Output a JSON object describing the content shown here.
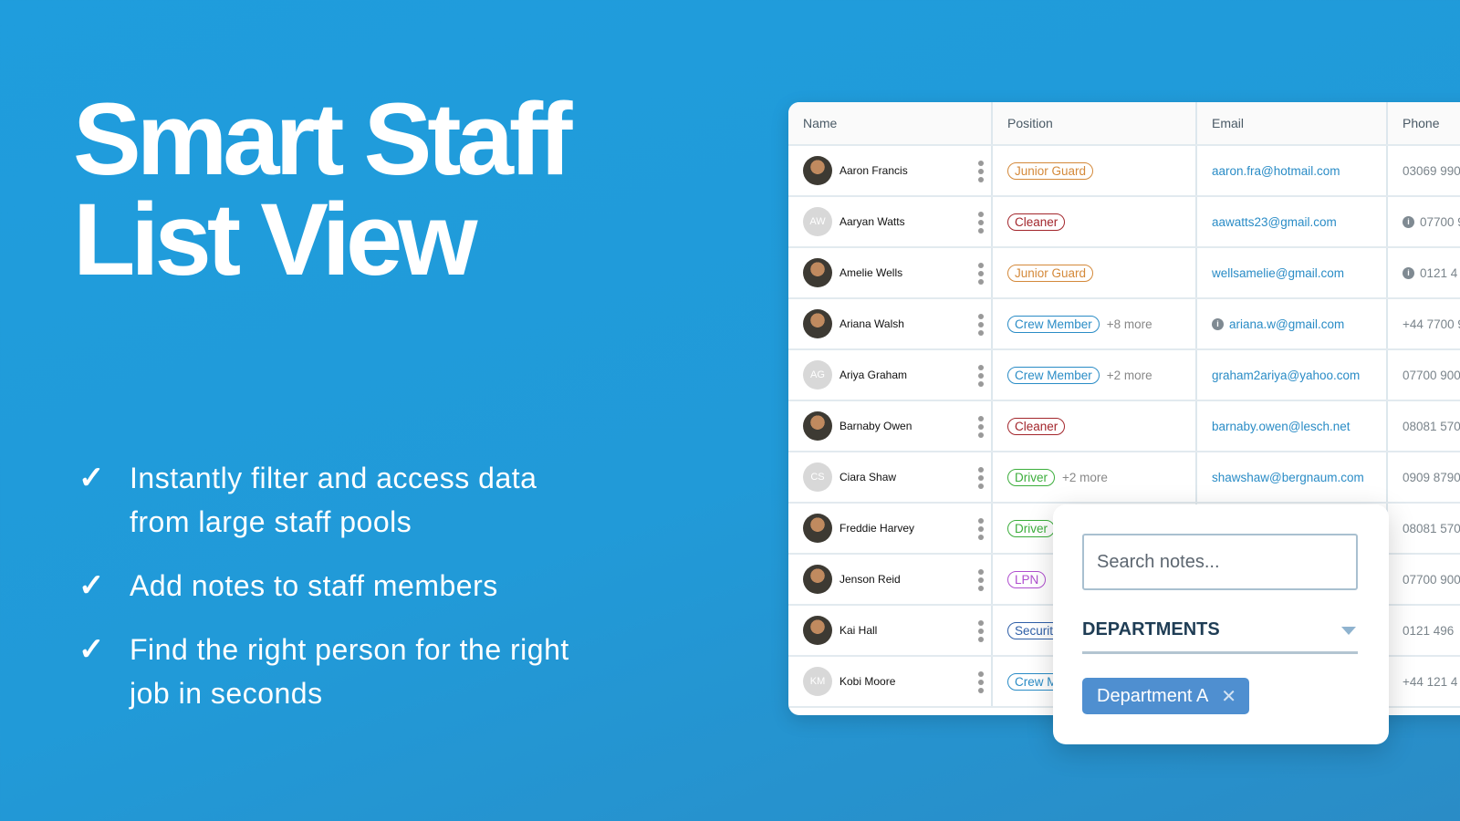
{
  "hero": {
    "title_line1": "Smart Staff",
    "title_line2": "List View",
    "bullets": [
      "Instantly filter and access data from large staff pools",
      "Add notes to staff members",
      "Find the right person for the right job in seconds"
    ]
  },
  "table": {
    "columns": [
      "Name",
      "Position",
      "Email",
      "Phone"
    ],
    "rows": [
      {
        "initials": "",
        "name": "Aaron Francis",
        "position": "Junior Guard",
        "pos_color": "#d4893a",
        "more": "",
        "email": "aaron.fra@hotmail.com",
        "email_info": false,
        "phone": "03069 990",
        "phone_info": false
      },
      {
        "initials": "AW",
        "name": "Aaryan Watts",
        "position": "Cleaner",
        "pos_color": "#a3262c",
        "more": "",
        "email": "aawatts23@gmail.com",
        "email_info": false,
        "phone": "07700 9",
        "phone_info": true
      },
      {
        "initials": "",
        "name": "Amelie Wells",
        "position": "Junior Guard",
        "pos_color": "#d4893a",
        "more": "",
        "email": "wellsamelie@gmail.com",
        "email_info": false,
        "phone": "0121 4",
        "phone_info": true
      },
      {
        "initials": "",
        "name": "Ariana Walsh",
        "position": "Crew Member",
        "pos_color": "#2a8cc6",
        "more": "+8 more",
        "email": "ariana.w@gmail.com",
        "email_info": true,
        "phone": "+44 7700 9",
        "phone_info": false
      },
      {
        "initials": "AG",
        "name": "Ariya Graham",
        "position": "Crew Member",
        "pos_color": "#2a8cc6",
        "more": "+2 more",
        "email": "graham2ariya@yahoo.com",
        "email_info": false,
        "phone": "07700 900",
        "phone_info": false
      },
      {
        "initials": "",
        "name": "Barnaby Owen",
        "position": "Cleaner",
        "pos_color": "#a3262c",
        "more": "",
        "email": "barnaby.owen@lesch.net",
        "email_info": false,
        "phone": "08081 570",
        "phone_info": false
      },
      {
        "initials": "CS",
        "name": "Ciara Shaw",
        "position": "Driver",
        "pos_color": "#3cae3c",
        "more": "+2 more",
        "email": "shawshaw@bergnaum.com",
        "email_info": false,
        "phone": "0909 8790",
        "phone_info": false
      },
      {
        "initials": "",
        "name": "Freddie Harvey",
        "position": "Driver",
        "pos_color": "#3cae3c",
        "more": "",
        "email": "",
        "email_info": false,
        "phone": "08081 570",
        "phone_info": false
      },
      {
        "initials": "",
        "name": "Jenson Reid",
        "position": "LPN",
        "pos_color": "#b04fcf",
        "more": "",
        "email": "",
        "email_info": false,
        "phone": "07700 900",
        "phone_info": false
      },
      {
        "initials": "",
        "name": "Kai Hall",
        "position": "Security",
        "pos_color": "#2f5fa8",
        "more": "",
        "email": "",
        "email_info": false,
        "phone": "0121 496",
        "phone_info": false
      },
      {
        "initials": "KM",
        "name": "Kobi Moore",
        "position": "Crew Member",
        "pos_color": "#2a8cc6",
        "more": "",
        "email": "",
        "email_info": false,
        "phone": "+44 121 4",
        "phone_info": false
      }
    ]
  },
  "popup": {
    "search_placeholder": "Search notes...",
    "departments_label": "DEPARTMENTS",
    "chip": "Department A",
    "chip_close": "✕"
  },
  "icons": {
    "check": "✓",
    "info": "i"
  }
}
